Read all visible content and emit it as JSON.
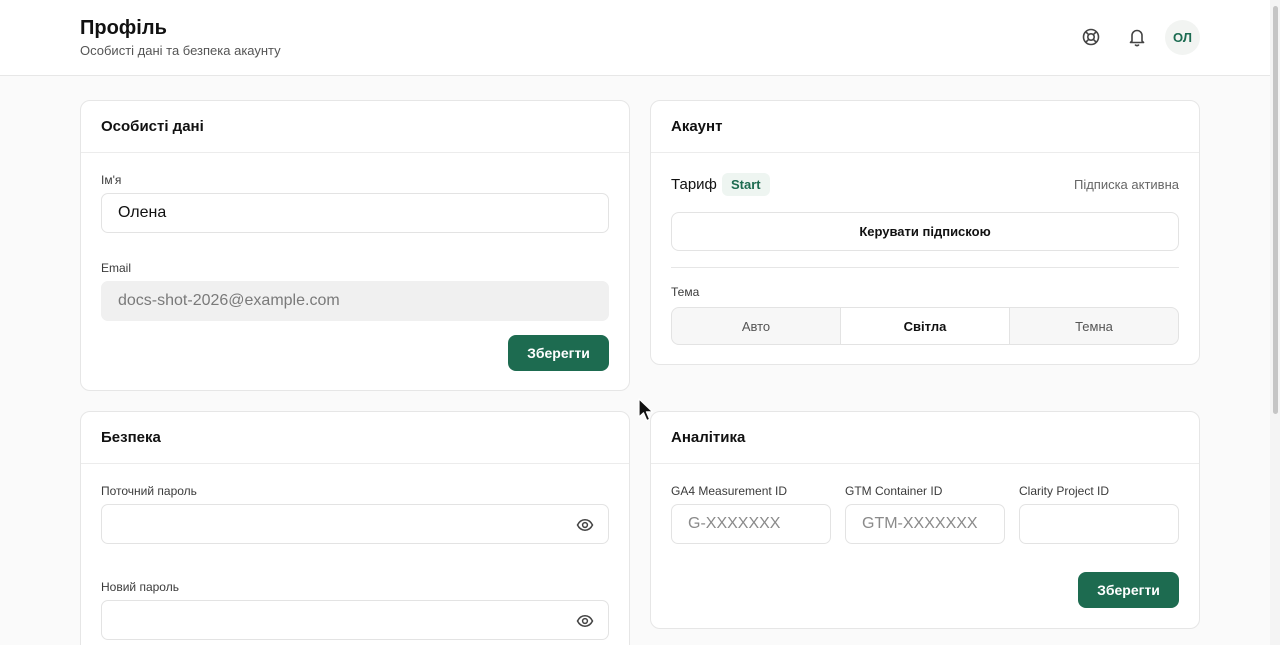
{
  "header": {
    "title": "Профіль",
    "subtitle": "Особисті дані та безпека акаунту",
    "avatar_initials": "ОЛ",
    "help_icon": "lifebuoy-icon",
    "notifications_icon": "bell-icon"
  },
  "personal": {
    "title": "Особисті дані",
    "name_label": "Ім'я",
    "name_value": "Олена",
    "email_label": "Email",
    "email_value": "docs-shot-2026@example.com",
    "save_label": "Зберегти"
  },
  "account": {
    "title": "Акаунт",
    "plan_label": "Тариф",
    "plan_value": "Start",
    "subscription_status": "Підписка активна",
    "manage_label": "Керувати підпискою",
    "theme_label": "Тема",
    "theme_options": [
      "Авто",
      "Світла",
      "Темна"
    ],
    "theme_selected": "Світла"
  },
  "security": {
    "title": "Безпека",
    "current_password_label": "Поточний пароль",
    "new_password_label": "Новий пароль"
  },
  "analytics": {
    "title": "Аналітика",
    "ga4_label": "GA4 Measurement ID",
    "ga4_placeholder": "G-XXXXXXX",
    "gtm_label": "GTM Container ID",
    "gtm_placeholder": "GTM-XXXXXXX",
    "clarity_label": "Clarity Project ID",
    "clarity_placeholder": "",
    "save_label": "Зберегти"
  },
  "colors": {
    "accent": "#1d6b50",
    "badge_bg": "#eef5f1"
  }
}
